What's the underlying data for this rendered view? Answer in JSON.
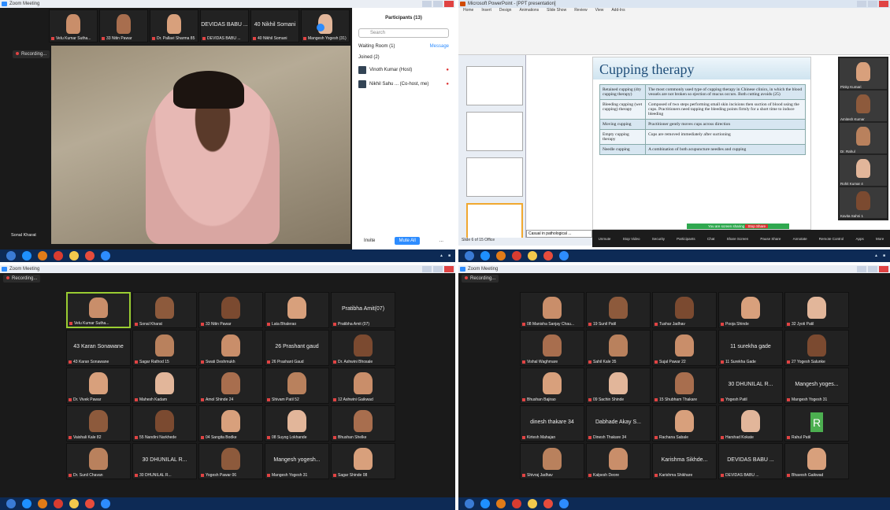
{
  "q1": {
    "titlebar": "Zoom Meeting",
    "recording": "Recording...",
    "top_strip": [
      {
        "name": "Velu Kumar Sutha..."
      },
      {
        "name": "33 Nitin Pawar"
      },
      {
        "name": "Dr. Pallavi Sharma 85"
      },
      {
        "name": "DEVIDAS BABU ...",
        "text": "DEVIDAS BABU ..."
      },
      {
        "name": "40 Nikhil Somani",
        "text": "40 Nikhil Somani"
      },
      {
        "name": "Mangesh Yogesh (31)"
      }
    ],
    "speaker_name": "Sonal Kharat",
    "participants": {
      "header": "Participants (13)",
      "search_placeholder": "Search",
      "waiting": "Waiting Room (1)",
      "message_btn": "Message",
      "joined": "Joined (2)",
      "rows": [
        {
          "name": "Vinoth Kumar (Host)"
        },
        {
          "name": "Nikhil Sahu ... (Co-host, me)"
        }
      ],
      "invite": "Invite",
      "mute_all": "Mute All",
      "more": "..."
    }
  },
  "q2": {
    "ppt_title": "Microsoft PowerPoint - [PPT presentation]",
    "tabs": [
      "Home",
      "Insert",
      "Design",
      "Animations",
      "Slide Show",
      "Review",
      "View",
      "Add-Ins"
    ],
    "slide_title": "Cupping therapy",
    "table": [
      [
        "Retained cupping (dry cupping therapy)",
        "The most commonly used type of cupping therapy in Chinese clinics, in which the blood vessels are not broken so ejection of mucus occurs. Both cutting avoids (25)"
      ],
      [
        "Bleeding cupping (wet cupping) therapy",
        "Composed of two steps performing small skin incisions then suction of blood using the cups. Practitioners need tapping the bleeding points firmly for a short time to induce bleeding"
      ],
      [
        "Moving cupping",
        "Practitioner gently moves cups across direction"
      ],
      [
        "Empty cupping therapy",
        "Cups are removed immediately after suctioning"
      ],
      [
        "Needle cupping",
        "A combination of both acupuncture needles and cupping"
      ]
    ],
    "share_bar": "You are screen sharing",
    "stop_share": "Stop Share",
    "casual_label": "Casual in pathological ...",
    "status": "Slide 6 of 15  Office",
    "toolbar": [
      "Unmute",
      "Stop Video",
      "Security",
      "Participants",
      "Chat",
      "Share Screen",
      "Pause Share",
      "Annotate",
      "Remote Control",
      "Apps",
      "More"
    ],
    "side_names": [
      "Pinky Kumari",
      "Amitesh Kumar",
      "Dr. Rahul",
      "Rohit Kumar 4",
      "Kavita Sahni 1"
    ]
  },
  "q3": {
    "titlebar": "Zoom Meeting",
    "recording": "Recording...",
    "tiles": [
      {
        "name": "Velu Kumar Sutha..."
      },
      {
        "name": "Sonal Kharat"
      },
      {
        "name": "33 Nitin Pawar"
      },
      {
        "name": "Lata Bhalerao"
      },
      {
        "name": "Pratibha Amit (07)",
        "text": "Pratibha Amit(07)"
      },
      {
        "name": "43 Karan Sonawane",
        "text": "43 Karan Sonawane"
      },
      {
        "name": "Sagar Rathod 15"
      },
      {
        "name": "Swati Deshmukh"
      },
      {
        "name": "26 Prashant Gaud",
        "text": "26 Prashant gaud"
      },
      {
        "name": "Dr. Ashwini Bhosale"
      },
      {
        "name": "Dr. Vivek Pawar"
      },
      {
        "name": "Mahesh Kadam"
      },
      {
        "name": "Amol Shinde 24"
      },
      {
        "name": "Shivam Patil 52"
      },
      {
        "name": "12 Ashwini Gaikwad"
      },
      {
        "name": "Vaishali Kale 82"
      },
      {
        "name": "55 Nandini Narkhede"
      },
      {
        "name": "04 Sangita Bodke"
      },
      {
        "name": "08 Suyog Lokhande"
      },
      {
        "name": "Bhushan Shelke"
      },
      {
        "name": "Dr. Sunil Chavan"
      },
      {
        "name": "30 DHUNILAL R...",
        "text": "30 DHUNILAL R..."
      },
      {
        "name": "Yogesh Pawar 06"
      },
      {
        "name": "Mangesh Yogesh 31",
        "text": "Mangesh yogesh..."
      },
      {
        "name": "Sagar Shinde 08"
      }
    ]
  },
  "q4": {
    "titlebar": "Zoom Meeting",
    "recording": "Recording...",
    "tiles": [
      {
        "name": "08 Manisha Sanjay Chau..."
      },
      {
        "name": "19 Sunil Patil"
      },
      {
        "name": "Tushar Jadhav"
      },
      {
        "name": "Pooja Shinde"
      },
      {
        "name": "32 Jyoti Patil"
      },
      {
        "name": "Vishal Waghmare"
      },
      {
        "name": "Sahil Kale 35"
      },
      {
        "name": "Sujal Pawar 22"
      },
      {
        "name": "11 Surekha Gade",
        "text": "11 surekha gade"
      },
      {
        "name": "27 Yogesh Salunke"
      },
      {
        "name": "Bhushan Bajirao"
      },
      {
        "name": "09 Sachin Shinde"
      },
      {
        "name": "15 Shubham Thakare"
      },
      {
        "name": "Yogesh Patil",
        "text": "30 DHUNILAL R..."
      },
      {
        "name": "Mangesh Yogesh 31",
        "text": "Mangesh yoges..."
      },
      {
        "name": "Kirtesh Mahajan",
        "text": "dinesh thakare 34"
      },
      {
        "name": "Dinesh Thakare 34",
        "text": "Dabhade Akay S..."
      },
      {
        "name": "Rachana Sabale"
      },
      {
        "name": "Harshad Kokate"
      },
      {
        "name": "Rahul Patil",
        "text": "R"
      },
      {
        "name": "Shivraj Jadhav"
      },
      {
        "name": "Kalpesh Deore"
      },
      {
        "name": "Karishma Shikhare",
        "text": "Karishma Sikhde..."
      },
      {
        "name": "DEVIDAS BABU ...",
        "text": "DEVIDAS BABU ..."
      },
      {
        "name": "Bhavesh Gaikwad"
      }
    ]
  }
}
